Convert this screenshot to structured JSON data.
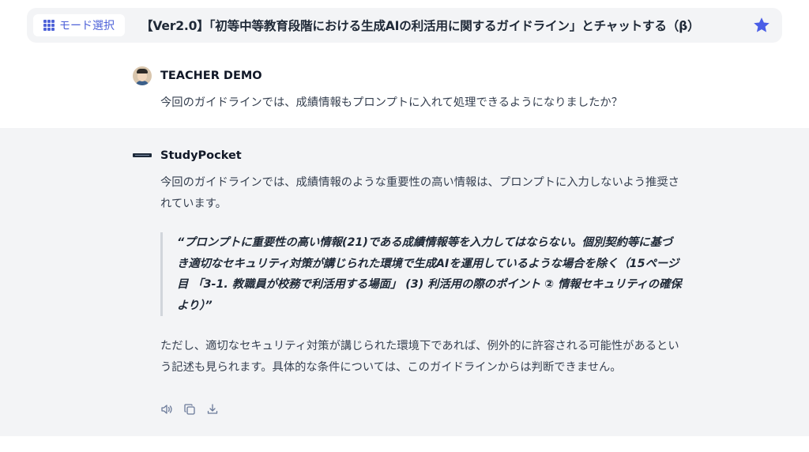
{
  "header": {
    "mode_button_label": "モード選択",
    "title": "【Ver2.0】「初等中等教育段階における生成AIの利活用に関するガイドライン」とチャットする（β）"
  },
  "messages": {
    "user": {
      "name": "TEACHER DEMO",
      "text": "今回のガイドラインでは、成績情報もプロンプトに入れて処理できるようになりましたか？"
    },
    "assistant": {
      "name": "StudyPocket",
      "paragraph1": "今回のガイドラインでは、成績情報のような重要性の高い情報は、プロンプトに入力しないよう推奨されています。",
      "quote": "“プロンプトに重要性の高い情報(21)である成績情報等を入力してはならない。個別契約等に基づき適切なセキュリティ対策が講じられた環境で生成AIを運用しているような場合を除く（15ページ目 「3-1. 教職員が校務で利活用する場面」 (3) 利活用の際のポイント ② 情報セキュリティの確保 より）”",
      "paragraph2": "ただし、適切なセキュリティ対策が講じられた環境下であれば、例外的に許容される可能性があるという記述も見られます。具体的な条件については、このガイドラインからは判断できません。"
    }
  },
  "icons": {
    "mode": "grid-icon",
    "favorite": "star-icon",
    "actions": [
      "speaker-icon",
      "copy-icon",
      "download-icon"
    ]
  },
  "colors": {
    "accent": "#4f63d8",
    "star": "#4a5ee6",
    "header_bg": "#f3f4f6",
    "assistant_bg": "#f3f4f6"
  }
}
